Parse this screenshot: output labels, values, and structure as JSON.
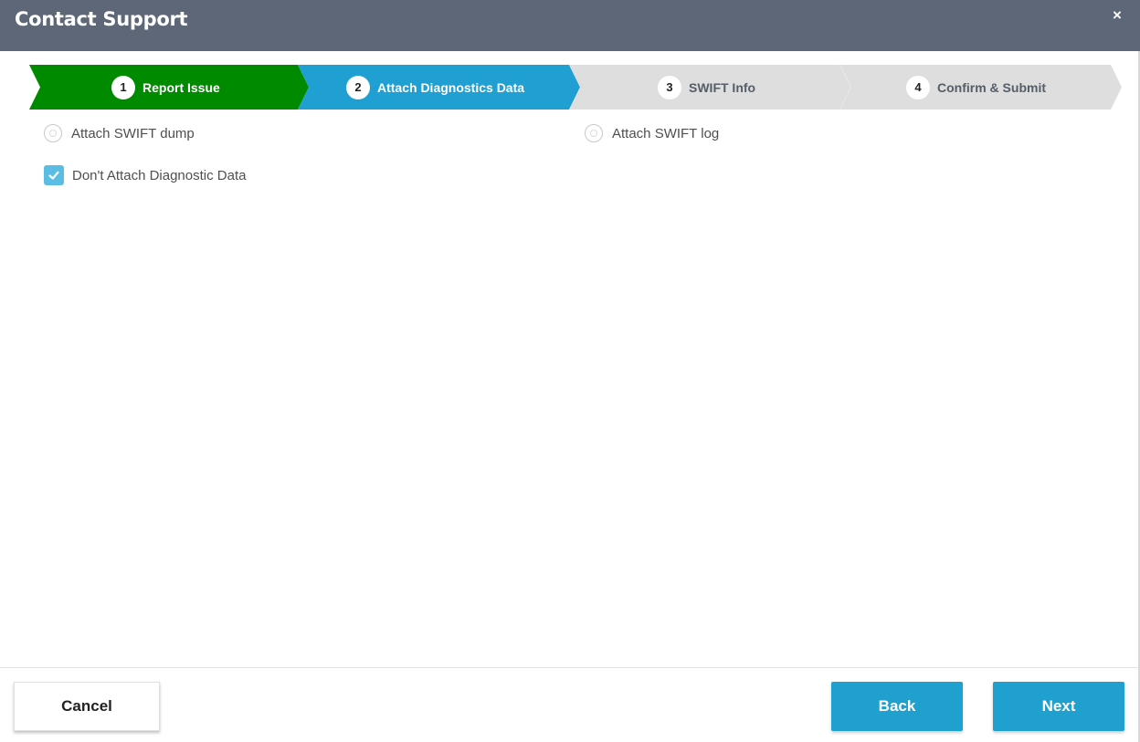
{
  "dialog": {
    "title": "Contact Support",
    "close_icon": "×"
  },
  "wizard": {
    "steps": [
      {
        "number": "1",
        "label": "Report Issue",
        "state": "complete",
        "color": "#008a00"
      },
      {
        "number": "2",
        "label": "Attach Diagnostics Data",
        "state": "active",
        "color": "#1f9fd2"
      },
      {
        "number": "3",
        "label": "SWIFT Info",
        "state": "pending",
        "color": "#dedede"
      },
      {
        "number": "4",
        "label": "Confirm & Submit",
        "state": "pending",
        "color": "#dedede"
      }
    ]
  },
  "options": {
    "attach_dump": {
      "label": "Attach SWIFT dump",
      "selected": false
    },
    "attach_log": {
      "label": "Attach SWIFT log",
      "selected": false
    },
    "dont_attach": {
      "label": "Don't Attach Diagnostic Data",
      "checked": true
    }
  },
  "footer": {
    "cancel_label": "Cancel",
    "back_label": "Back",
    "next_label": "Next"
  },
  "colors": {
    "header_bg": "#5d6778",
    "accent": "#20a0cf",
    "complete": "#008a00"
  }
}
